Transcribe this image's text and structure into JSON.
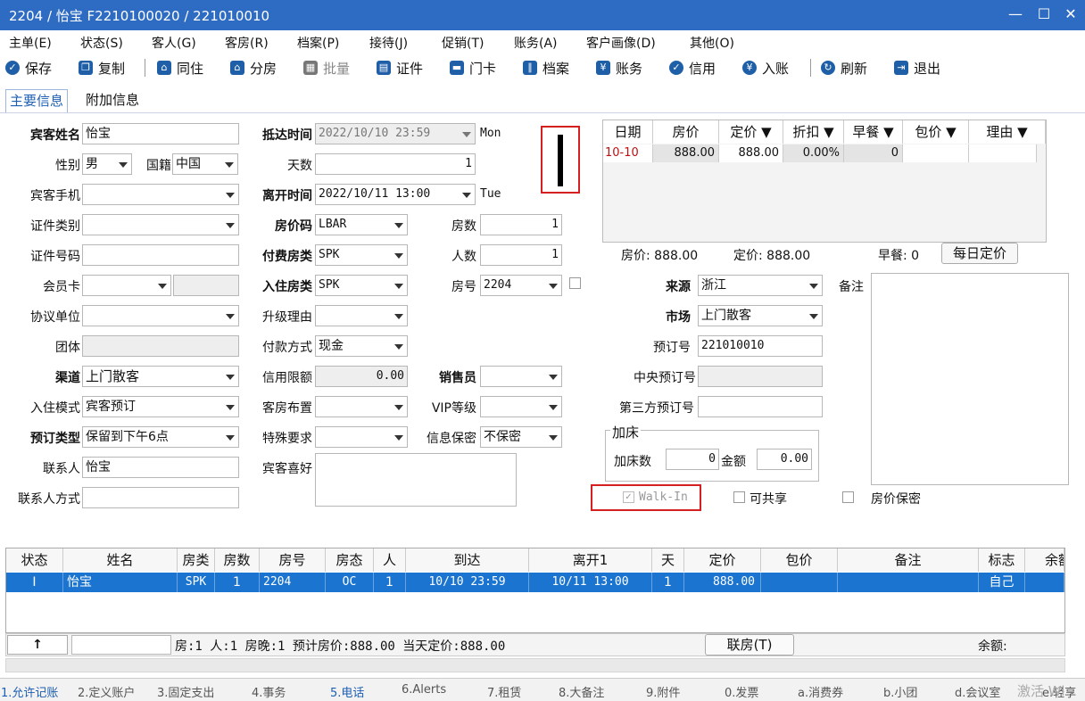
{
  "window": {
    "title": "2204 / 怡宝 F2210100020 / 221010010",
    "minimize": "—",
    "maximize": "☐",
    "close": "✕"
  },
  "menu": [
    "主单(E)",
    "状态(S)",
    "客人(G)",
    "客房(R)",
    "档案(P)",
    "接待(J)",
    "促销(T)",
    "账务(A)",
    "客户画像(D)",
    "其他(O)"
  ],
  "toolbar": {
    "save": "保存",
    "copy": "复制",
    "share": "同住",
    "split": "分房",
    "batch": "批量",
    "id": "证件",
    "card": "门卡",
    "archive": "档案",
    "account": "账务",
    "credit": "信用",
    "deposit": "入账",
    "refresh": "刷新",
    "exit": "退出"
  },
  "tabs": {
    "main": "主要信息",
    "extra": "附加信息"
  },
  "col1": {
    "guest_name_label": "宾客姓名",
    "guest_name": "怡宝",
    "gender_label": "性别",
    "gender": "男",
    "nation_label": "国籍",
    "nation": "中国",
    "mobile_label": "宾客手机",
    "mobile": "",
    "id_type_label": "证件类别",
    "id_type": "",
    "id_no_label": "证件号码",
    "id_no": "",
    "member_label": "会员卡",
    "member": "",
    "agreement_label": "协议单位",
    "agreement": "",
    "group_label": "团体",
    "group": "",
    "channel_label": "渠道",
    "channel": "上门散客",
    "checkin_mode_label": "入住模式",
    "checkin_mode": "宾客预订",
    "res_type_label": "预订类型",
    "res_type": "保留到下午6点",
    "contact_label": "联系人",
    "contact": "怡宝",
    "contact_method_label": "联系人方式",
    "contact_method": ""
  },
  "col2": {
    "arrival_label": "抵达时间",
    "arrival": "2022/10/10 23:59",
    "arrival_day": "Mon",
    "days_label": "天数",
    "days": "1",
    "departure_label": "离开时间",
    "departure": "2022/10/11 13:00",
    "departure_day": "Tue",
    "rate_code_label": "房价码",
    "rate_code": "LBAR",
    "pay_room_label": "付费房类",
    "pay_room": "SPK",
    "checkin_room_label": "入住房类",
    "checkin_room": "SPK",
    "upgrade_label": "升级理由",
    "upgrade": "",
    "payment_label": "付款方式",
    "payment": "现金",
    "credit_limit_label": "信用限额",
    "credit_limit": "0.00",
    "layout_label": "客房布置",
    "layout": "",
    "special_label": "特殊要求",
    "special": "",
    "preference_label": "宾客喜好",
    "preference": ""
  },
  "col3": {
    "rooms_label": "房数",
    "rooms": "1",
    "persons_label": "人数",
    "persons": "1",
    "room_no_label": "房号",
    "room_no": "2204",
    "sales_label": "销售员",
    "sales": "",
    "vip_label": "VIP等级",
    "vip": "",
    "privacy_label": "信息保密",
    "privacy": "不保密"
  },
  "rate_table": {
    "headers": [
      "日期",
      "房价",
      "定价 ▼",
      "折扣 ▼",
      "早餐 ▼",
      "包价 ▼",
      "理由 ▼"
    ],
    "rows": [
      [
        "10-10",
        "888.00",
        "888.00",
        "0.00%",
        "0",
        "",
        ""
      ]
    ],
    "summary_rate": "房价: 888.00",
    "summary_fixed": "定价: 888.00",
    "summary_breakfast": "早餐: 0",
    "daily_button": "每日定价"
  },
  "col4": {
    "source_label": "来源",
    "source": "浙江",
    "market_label": "市场",
    "market": "上门散客",
    "res_no_label": "预订号",
    "res_no": "221010010",
    "central_label": "中央预订号",
    "central": "",
    "third_label": "第三方预订号",
    "third": "",
    "extra_bed_group": "加床",
    "extra_bed_count_label": "加床数",
    "extra_bed_count": "0",
    "extra_bed_amount_label": "金额",
    "extra_bed_amount": "0.00",
    "remark_label": "备注",
    "remark": "",
    "walkin": "Walk-In",
    "shareable": "可共享",
    "rate_secret": "房价保密"
  },
  "grid": {
    "headers": [
      "状态",
      "姓名",
      "房类",
      "房数",
      "房号",
      "房态",
      "人",
      "到达",
      "离开1",
      "天",
      "定价",
      "包价",
      "备注",
      "标志",
      "余额"
    ],
    "rows": [
      [
        "I",
        "怡宝",
        "SPK",
        "1",
        "2204",
        "OC",
        "1",
        "10/10 23:59",
        "10/11 13:00",
        "1",
        "888.00",
        "",
        "",
        "自己",
        ""
      ]
    ]
  },
  "footer": {
    "arrow": "↑",
    "summary": "房:1  人:1  房晚:1  预计房价:888.00  当天定价:888.00",
    "link_button": "联房(T)",
    "balance_label": "余额:"
  },
  "bottom_tabs": [
    "1.允许记账",
    "2.定义账户",
    "3.固定支出",
    "4.事务",
    "5.电话",
    "6.Alerts",
    "7.租赁",
    "8.大备注",
    "9.附件",
    "0.发票",
    "a.消费券",
    "b.小团",
    "d.会议室",
    "e.轻享"
  ],
  "watermark": "激活 Wi"
}
